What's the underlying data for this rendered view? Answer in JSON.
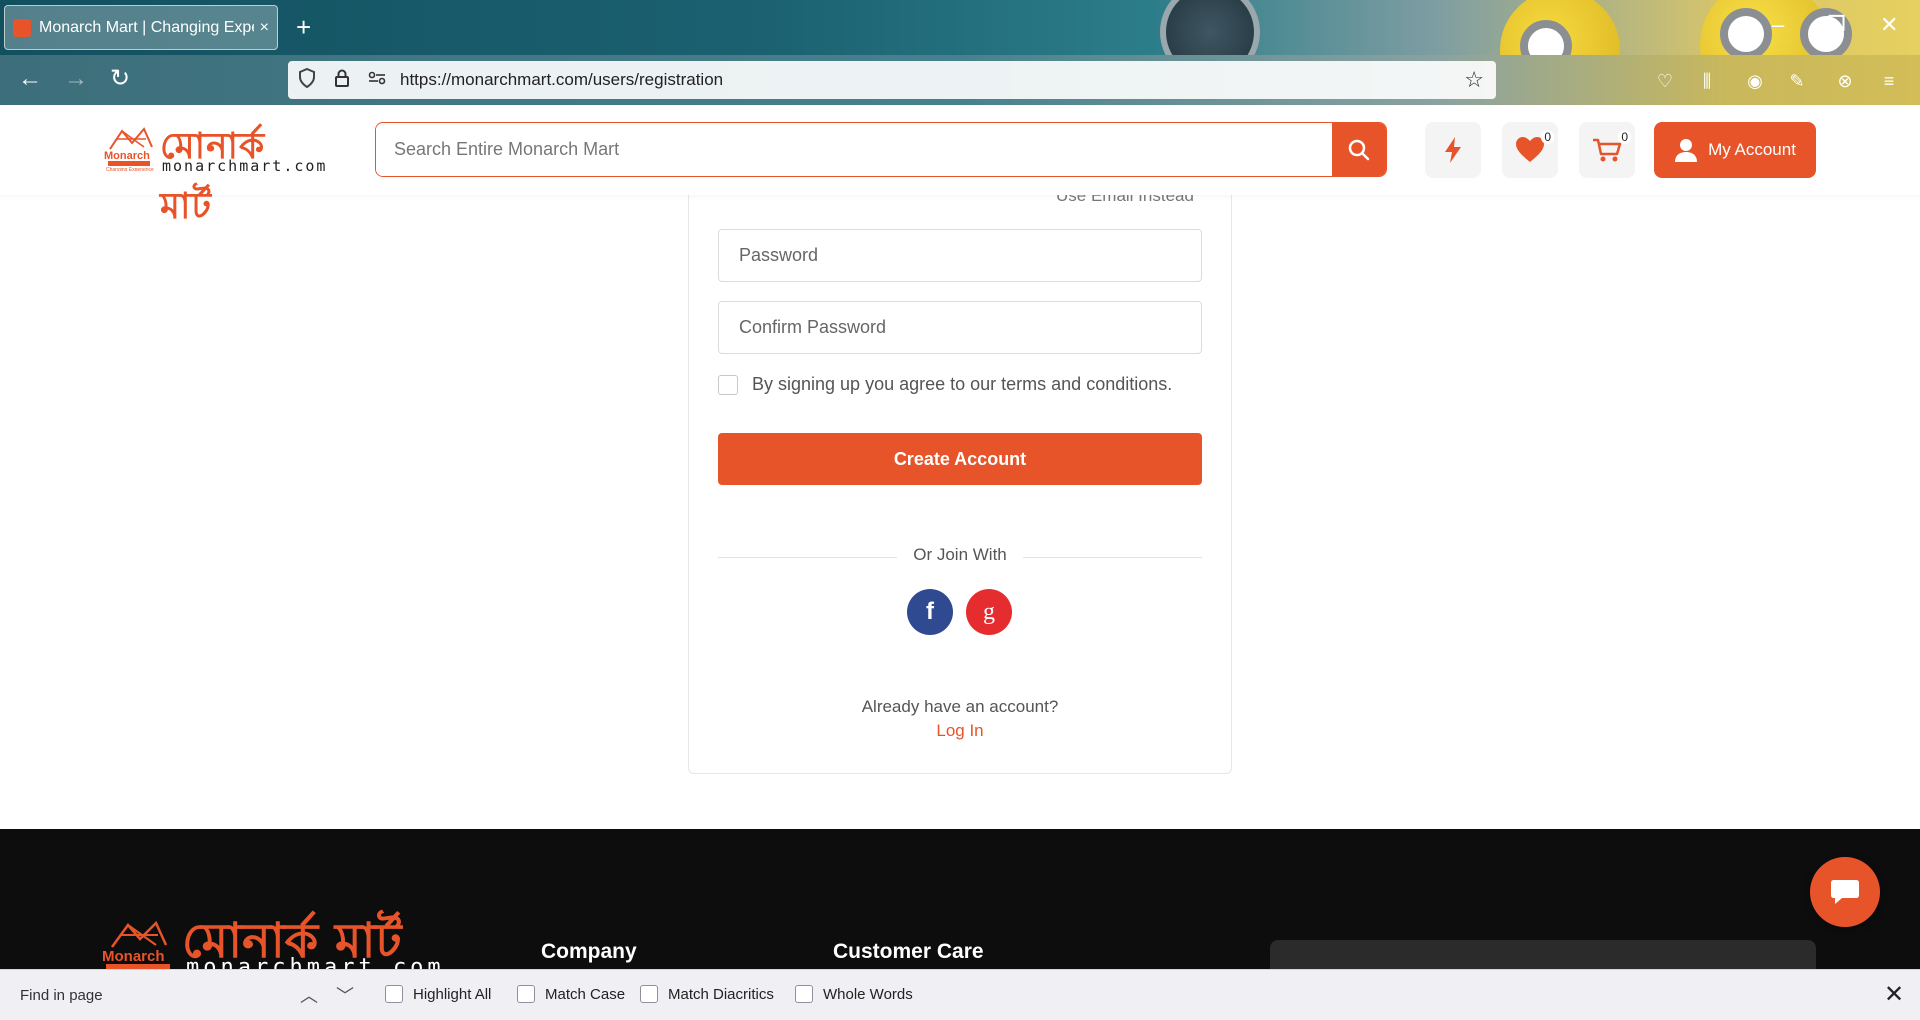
{
  "browser": {
    "tab_title": "Monarch Mart | Changing Experience",
    "tab_close": "×",
    "new_tab": "+",
    "url": "https://monarchmart.com/users/registration"
  },
  "header": {
    "logo_bn": "মোনার্ক মার্ট",
    "logo_domain": "monarchmart.com",
    "search_placeholder": "Search Entire Monarch Mart",
    "wishlist_count": "0",
    "cart_count": "0",
    "account_label": "My Account"
  },
  "form": {
    "use_email_link": "Use Email Instead",
    "password_placeholder": "Password",
    "confirm_password_placeholder": "Confirm Password",
    "terms_text": "By signing up you agree to our terms and conditions.",
    "create_account_label": "Create Account",
    "or_join_with": "Or Join With",
    "facebook_glyph": "f",
    "google_glyph": "g",
    "already_have_account": "Already have an account?",
    "login_link": "Log In"
  },
  "footer": {
    "logo_bn": "মোনার্ক মার্ট",
    "logo_domain": "monarchmart.com",
    "company_heading": "Company",
    "customer_care_heading": "Customer Care"
  },
  "findbar": {
    "placeholder": "Find in page",
    "highlight_all": "Highlight All",
    "match_case": "Match Case",
    "match_diacritics": "Match Diacritics",
    "whole_words": "Whole Words"
  },
  "colors": {
    "brand": "#e8542a",
    "facebook": "#2f4a91",
    "google": "#e52d2f",
    "footer_bg": "#0d0d0d"
  }
}
